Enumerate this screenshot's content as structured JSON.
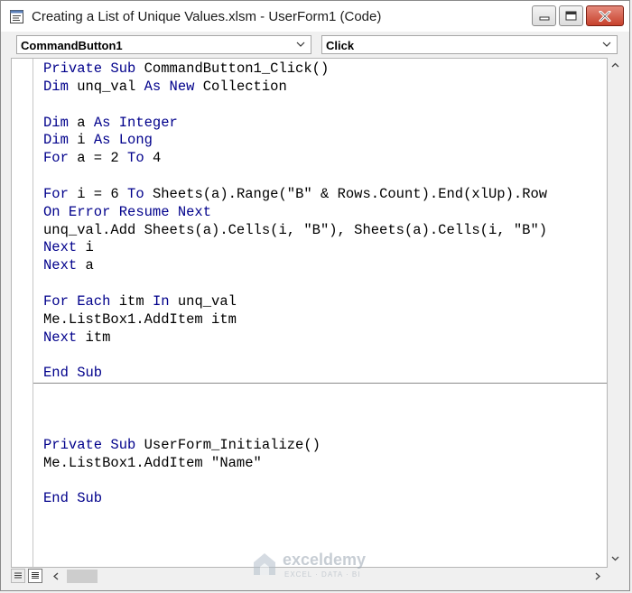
{
  "window": {
    "title": "Creating a List of Unique Values.xlsm - UserForm1 (Code)",
    "app_icon": "vba-code-window-icon",
    "controls": [
      "minimize-icon",
      "maximize-icon",
      "close-icon"
    ]
  },
  "dropdowns": {
    "object": "CommandButton1",
    "procedure": "Click"
  },
  "code": {
    "keyword_color": "#00008b",
    "lines": [
      [
        {
          "t": "Private Sub",
          "k": 1
        },
        {
          "t": " CommandButton1_Click()"
        }
      ],
      [
        {
          "t": "Dim",
          "k": 1
        },
        {
          "t": " unq_val "
        },
        {
          "t": "As New",
          "k": 1
        },
        {
          "t": " Collection"
        }
      ],
      [],
      [
        {
          "t": "Dim",
          "k": 1
        },
        {
          "t": " a "
        },
        {
          "t": "As Integer",
          "k": 1
        }
      ],
      [
        {
          "t": "Dim",
          "k": 1
        },
        {
          "t": " i "
        },
        {
          "t": "As Long",
          "k": 1
        }
      ],
      [
        {
          "t": "For",
          "k": 1
        },
        {
          "t": " a = 2 "
        },
        {
          "t": "To",
          "k": 1
        },
        {
          "t": " 4"
        }
      ],
      [],
      [
        {
          "t": "For",
          "k": 1
        },
        {
          "t": " i = 6 "
        },
        {
          "t": "To",
          "k": 1
        },
        {
          "t": " Sheets(a).Range(\"B\" & Rows.Count).End(xlUp).Row"
        }
      ],
      [
        {
          "t": "On Error Resume Next",
          "k": 1
        }
      ],
      [
        {
          "t": "unq_val.Add Sheets(a).Cells(i, \"B\"), Sheets(a).Cells(i, \"B\")"
        }
      ],
      [
        {
          "t": "Next",
          "k": 1
        },
        {
          "t": " i"
        }
      ],
      [
        {
          "t": "Next",
          "k": 1
        },
        {
          "t": " a"
        }
      ],
      [],
      [
        {
          "t": "For Each",
          "k": 1
        },
        {
          "t": " itm "
        },
        {
          "t": "In",
          "k": 1
        },
        {
          "t": " unq_val"
        }
      ],
      [
        {
          "t": "Me.ListBox1.AddItem itm"
        }
      ],
      [
        {
          "t": "Next",
          "k": 1
        },
        {
          "t": " itm"
        }
      ],
      [],
      [
        {
          "t": "End Sub",
          "k": 1
        }
      ],
      [],
      [],
      [],
      [
        {
          "t": "Private Sub",
          "k": 1
        },
        {
          "t": " UserForm_Initialize()"
        }
      ],
      [
        {
          "t": "Me.ListBox1.AddItem \"Name\""
        }
      ],
      [],
      [
        {
          "t": "End Sub",
          "k": 1
        }
      ]
    ]
  },
  "watermark": {
    "name": "exceldemy",
    "sub": "EXCEL · DATA · BI"
  }
}
